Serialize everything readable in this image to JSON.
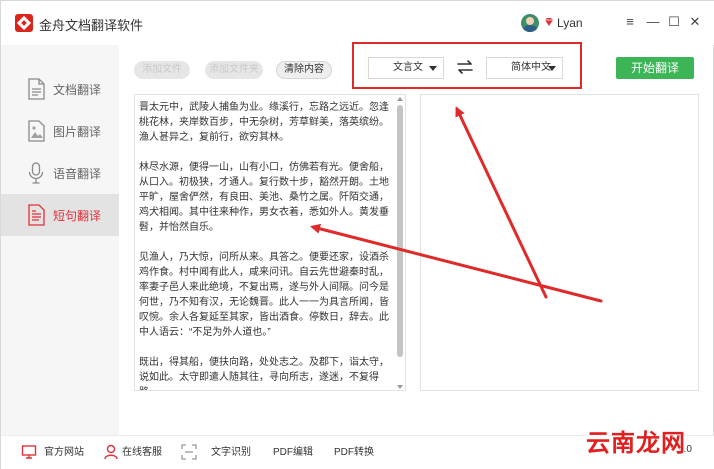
{
  "app": {
    "title": "金舟文档翻译软件",
    "username": "Lyan"
  },
  "window_controls": {
    "menu": "≡",
    "minimize": "—",
    "maximize": "☐",
    "close": "✕"
  },
  "sidebar": {
    "items": [
      {
        "label": "文档翻译",
        "icon": "document-icon",
        "active": false
      },
      {
        "label": "图片翻译",
        "icon": "image-icon",
        "active": false
      },
      {
        "label": "语音翻译",
        "icon": "microphone-icon",
        "active": false
      },
      {
        "label": "短句翻译",
        "icon": "sentence-doc-icon",
        "active": true
      }
    ]
  },
  "toolbar": {
    "add_file": "添加文件",
    "add_folder": "添加文件夹",
    "clear": "清除内容",
    "source_lang": "文言文",
    "target_lang": "简体中文",
    "start": "开始翻译"
  },
  "source_text": {
    "paragraphs": [
      "晋太元中，武陵人捕鱼为业。缘溪行，忘路之远近。忽逢桃花林，夹岸数百步，中无杂树，芳草鲜美，落英缤纷。渔人甚异之，复前行，欲穷其林。",
      "林尽水源，便得一山，山有小口，仿佛若有光。便舍船，从口入。初极狭，才通人。复行数十步，豁然开朗。土地平旷，屋舍俨然，有良田、美池、桑竹之属。阡陌交通，鸡犬相闻。其中往来种作，男女衣着，悉如外人。黄发垂髫，并怡然自乐。",
      "见渔人，乃大惊，问所从来。具答之。便要还家，设酒杀鸡作食。村中闻有此人，咸来问讯。自云先世避秦时乱，率妻子邑人来此绝境，不复出焉，遂与外人间隔。问今是何世，乃不知有汉，无论魏晋。此人一一为具言所闻，皆叹惋。余人各复延至其家，皆出酒食。停数日，辞去。此中人语云：“不足为外人道也。”",
      "既出，得其船，便扶向路，处处志之。及郡下，诣太守，说如此。太守即遣人随其往，寻向所志，遂迷，不复得路。"
    ]
  },
  "target_text": "",
  "bottom_bar": {
    "official_site": "官方网站",
    "online_support": "在线客服",
    "ocr": "文字识别",
    "pdf_edit": "PDF编辑",
    "pdf_convert": "PDF转换",
    "version": "9.0"
  },
  "watermark": "云南龙网",
  "colors": {
    "accent_red": "#e02a2a",
    "start_green": "#3bb556",
    "active_nav_text": "#e0323a"
  }
}
